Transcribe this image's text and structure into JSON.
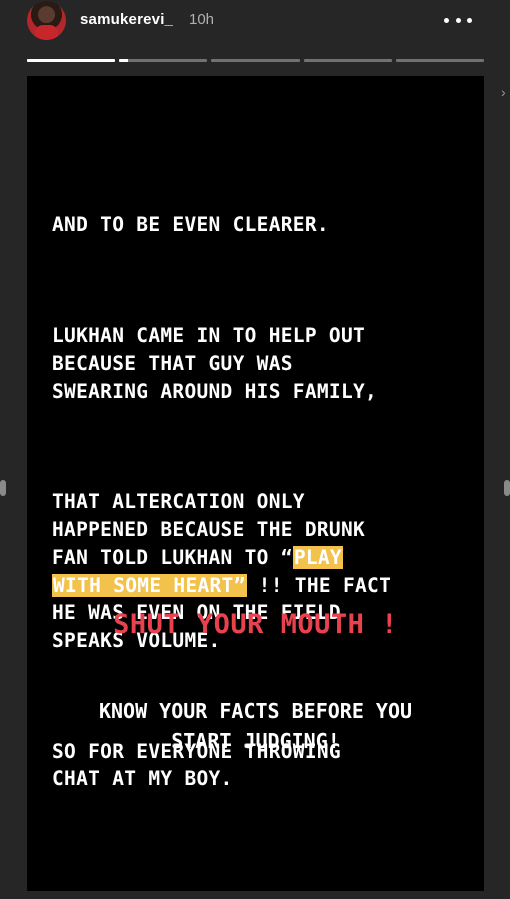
{
  "header": {
    "username": "samukerevi_",
    "time": "10h",
    "avatar_icon": "profile-avatar",
    "more_icon": "more-options-icon"
  },
  "progress": {
    "segments": 5,
    "active_index": 1,
    "active_fraction": 0.1
  },
  "story": {
    "paragraphs": [
      [
        "AND TO BE EVEN CLEARER."
      ],
      [
        "LUKHAN CAME IN TO HELP OUT",
        "BECAUSE THAT GUY WAS",
        "SWEARING AROUND HIS FAMILY,"
      ],
      [
        "THAT ALTERCATION ONLY",
        "HAPPENED BECAUSE THE DRUNK"
      ]
    ],
    "line_fan_prefix": "FAN TOLD LUKHAN TO “",
    "highlight_1": "PLAY",
    "highlight_2": "WITH SOME HEART”",
    "line_after_highlight": " !! THE FACT",
    "line_he_was": "HE WAS EVEN ON THE FIELD",
    "line_speaks": "SPEAKS VOLUME.",
    "line_so_for": "SO FOR EVERYONE THROWING",
    "line_chat": "CHAT AT MY BOY.",
    "shout": "SHUT YOUR MOUTH !",
    "closing_1": "KNOW YOUR FACTS BEFORE YOU",
    "closing_2": "START JUDGING!"
  },
  "colors": {
    "shout": "#e9424f",
    "highlight": "#f2c24c",
    "story_bg": "#000000",
    "app_bg": "#262626"
  }
}
